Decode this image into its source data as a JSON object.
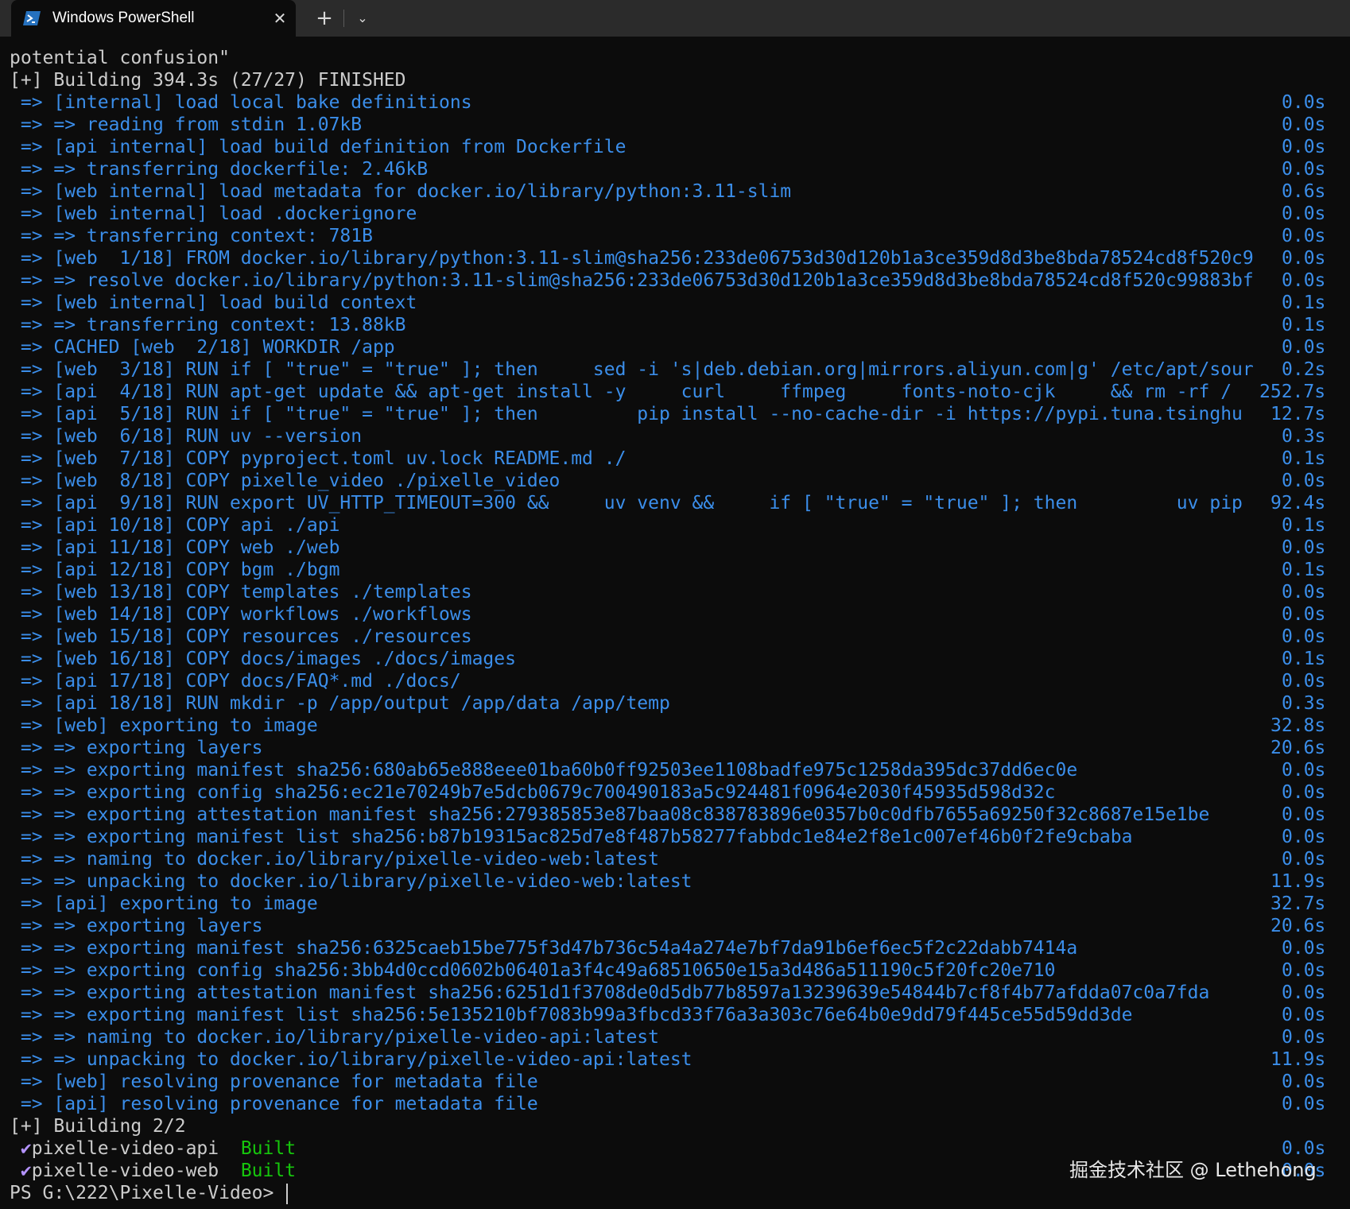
{
  "tab": {
    "title": "Windows PowerShell",
    "icon": "powershell-icon",
    "close_glyph": "✕",
    "new_tab_glyph": "+",
    "dropdown_glyph": "⌄"
  },
  "colors": {
    "background": "#0c0c0c",
    "text": "#cccccc",
    "blue": "#3b8eea",
    "green": "#16c60c",
    "check": "#b493ff"
  },
  "output": [
    {
      "text": "potential confusion\"",
      "style": "white"
    },
    {
      "text": "[+] Building 394.3s (27/27) FINISHED",
      "style": "white"
    },
    {
      "text": " => [internal] load local bake definitions",
      "time": "0.0s",
      "style": "blue"
    },
    {
      "text": " => => reading from stdin 1.07kB",
      "time": "0.0s",
      "style": "blue"
    },
    {
      "text": " => [api internal] load build definition from Dockerfile",
      "time": "0.0s",
      "style": "blue"
    },
    {
      "text": " => => transferring dockerfile: 2.46kB",
      "time": "0.0s",
      "style": "blue"
    },
    {
      "text": " => [web internal] load metadata for docker.io/library/python:3.11-slim",
      "time": "0.6s",
      "style": "blue"
    },
    {
      "text": " => [web internal] load .dockerignore",
      "time": "0.0s",
      "style": "blue"
    },
    {
      "text": " => => transferring context: 781B",
      "time": "0.0s",
      "style": "blue"
    },
    {
      "text": " => [web  1/18] FROM docker.io/library/python:3.11-slim@sha256:233de06753d30d120b1a3ce359d8d3be8bda78524cd8f520c9",
      "time": "0.0s",
      "style": "blue"
    },
    {
      "text": " => => resolve docker.io/library/python:3.11-slim@sha256:233de06753d30d120b1a3ce359d8d3be8bda78524cd8f520c99883bf",
      "time": "0.0s",
      "style": "blue"
    },
    {
      "text": " => [web internal] load build context",
      "time": "0.1s",
      "style": "blue"
    },
    {
      "text": " => => transferring context: 13.88kB",
      "time": "0.1s",
      "style": "blue"
    },
    {
      "text": " => CACHED [web  2/18] WORKDIR /app",
      "time": "0.0s",
      "style": "blue"
    },
    {
      "text": " => [web  3/18] RUN if [ \"true\" = \"true\" ]; then     sed -i 's|deb.debian.org|mirrors.aliyun.com|g' /etc/apt/sour",
      "time": "0.2s",
      "style": "blue"
    },
    {
      "text": " => [api  4/18] RUN apt-get update && apt-get install -y     curl     ffmpeg     fonts-noto-cjk     && rm -rf /",
      "time": "252.7s",
      "style": "blue"
    },
    {
      "text": " => [api  5/18] RUN if [ \"true\" = \"true\" ]; then         pip install --no-cache-dir -i https://pypi.tuna.tsinghu",
      "time": "12.7s",
      "style": "blue"
    },
    {
      "text": " => [web  6/18] RUN uv --version",
      "time": "0.3s",
      "style": "blue"
    },
    {
      "text": " => [web  7/18] COPY pyproject.toml uv.lock README.md ./",
      "time": "0.1s",
      "style": "blue"
    },
    {
      "text": " => [web  8/18] COPY pixelle_video ./pixelle_video",
      "time": "0.0s",
      "style": "blue"
    },
    {
      "text": " => [api  9/18] RUN export UV_HTTP_TIMEOUT=300 &&     uv venv &&     if [ \"true\" = \"true\" ]; then         uv pip",
      "time": "92.4s",
      "style": "blue"
    },
    {
      "text": " => [api 10/18] COPY api ./api",
      "time": "0.1s",
      "style": "blue"
    },
    {
      "text": " => [api 11/18] COPY web ./web",
      "time": "0.0s",
      "style": "blue"
    },
    {
      "text": " => [api 12/18] COPY bgm ./bgm",
      "time": "0.1s",
      "style": "blue"
    },
    {
      "text": " => [web 13/18] COPY templates ./templates",
      "time": "0.0s",
      "style": "blue"
    },
    {
      "text": " => [web 14/18] COPY workflows ./workflows",
      "time": "0.0s",
      "style": "blue"
    },
    {
      "text": " => [web 15/18] COPY resources ./resources",
      "time": "0.0s",
      "style": "blue"
    },
    {
      "text": " => [web 16/18] COPY docs/images ./docs/images",
      "time": "0.1s",
      "style": "blue"
    },
    {
      "text": " => [api 17/18] COPY docs/FAQ*.md ./docs/",
      "time": "0.0s",
      "style": "blue"
    },
    {
      "text": " => [api 18/18] RUN mkdir -p /app/output /app/data /app/temp",
      "time": "0.3s",
      "style": "blue"
    },
    {
      "text": " => [web] exporting to image",
      "time": "32.8s",
      "style": "blue"
    },
    {
      "text": " => => exporting layers",
      "time": "20.6s",
      "style": "blue"
    },
    {
      "text": " => => exporting manifest sha256:680ab65e888eee01ba60b0ff92503ee1108badfe975c1258da395dc37dd6ec0e",
      "time": "0.0s",
      "style": "blue"
    },
    {
      "text": " => => exporting config sha256:ec21e70249b7e5dcb0679c700490183a5c924481f0964e2030f45935d598d32c",
      "time": "0.0s",
      "style": "blue"
    },
    {
      "text": " => => exporting attestation manifest sha256:279385853e87baa08c838783896e0357b0c0dfb7655a69250f32c8687e15e1be",
      "time": "0.0s",
      "style": "blue"
    },
    {
      "text": " => => exporting manifest list sha256:b87b19315ac825d7e8f487b58277fabbdc1e84e2f8e1c007ef46b0f2fe9cbaba",
      "time": "0.0s",
      "style": "blue"
    },
    {
      "text": " => => naming to docker.io/library/pixelle-video-web:latest",
      "time": "0.0s",
      "style": "blue"
    },
    {
      "text": " => => unpacking to docker.io/library/pixelle-video-web:latest",
      "time": "11.9s",
      "style": "blue"
    },
    {
      "text": " => [api] exporting to image",
      "time": "32.7s",
      "style": "blue"
    },
    {
      "text": " => => exporting layers",
      "time": "20.6s",
      "style": "blue"
    },
    {
      "text": " => => exporting manifest sha256:6325caeb15be775f3d47b736c54a4a274e7bf7da91b6ef6ec5f2c22dabb7414a",
      "time": "0.0s",
      "style": "blue"
    },
    {
      "text": " => => exporting config sha256:3bb4d0ccd0602b06401a3f4c49a68510650e15a3d486a511190c5f20fc20e710",
      "time": "0.0s",
      "style": "blue"
    },
    {
      "text": " => => exporting attestation manifest sha256:6251d1f3708de0d5db77b8597a13239639e54844b7cf8f4b77afdda07c0a7fda",
      "time": "0.0s",
      "style": "blue"
    },
    {
      "text": " => => exporting manifest list sha256:5e135210bf7083b99a3fbcd33f76a3a303c76e64b0e9dd79f445ce55d59dd3de",
      "time": "0.0s",
      "style": "blue"
    },
    {
      "text": " => => naming to docker.io/library/pixelle-video-api:latest",
      "time": "0.0s",
      "style": "blue"
    },
    {
      "text": " => => unpacking to docker.io/library/pixelle-video-api:latest",
      "time": "11.9s",
      "style": "blue"
    },
    {
      "text": " => [web] resolving provenance for metadata file",
      "time": "0.0s",
      "style": "blue"
    },
    {
      "text": " => [api] resolving provenance for metadata file",
      "time": "0.0s",
      "style": "blue"
    },
    {
      "text": "[+] Building 2/2",
      "style": "white"
    }
  ],
  "services": [
    {
      "check": "✔",
      "name": "pixelle-video-api",
      "status": "Built",
      "time": "0.0s"
    },
    {
      "check": "✔",
      "name": "pixelle-video-web",
      "status": "Built",
      "time": "0.0s"
    }
  ],
  "prompt": "PS G:\\222\\Pixelle-Video> ",
  "watermark": "掘金技术社区 @ Lethehong"
}
